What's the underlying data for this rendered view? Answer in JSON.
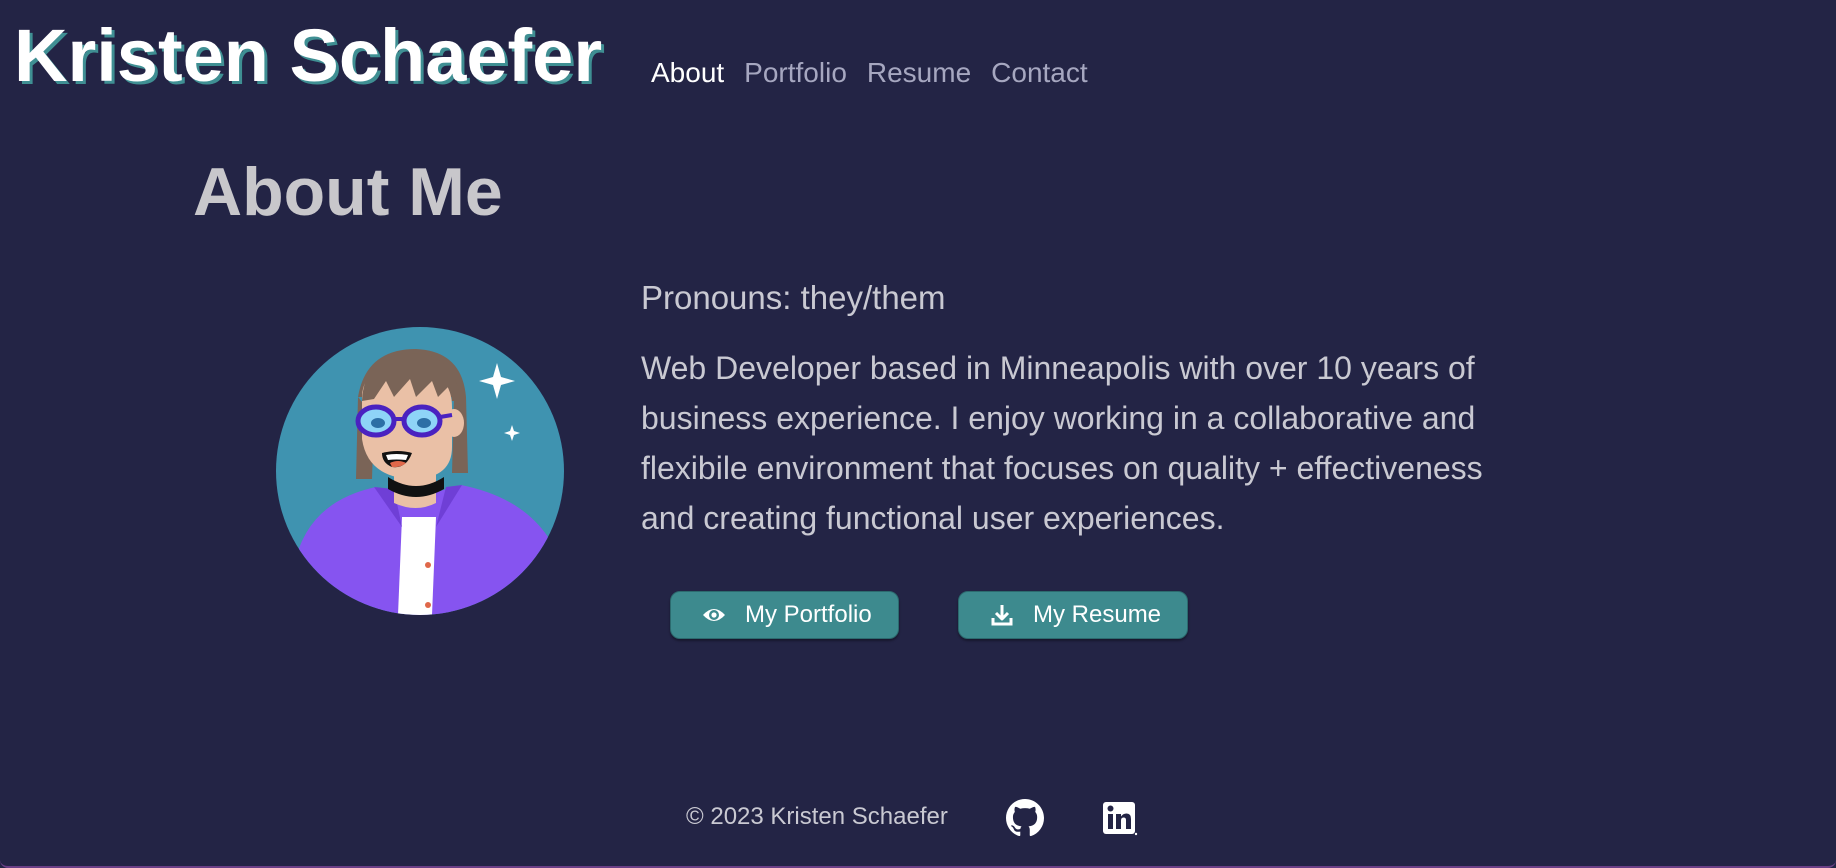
{
  "header": {
    "site_title": "Kristen Schaefer",
    "nav": [
      {
        "label": "About",
        "active": true
      },
      {
        "label": "Portfolio",
        "active": false
      },
      {
        "label": "Resume",
        "active": false
      },
      {
        "label": "Contact",
        "active": false
      }
    ]
  },
  "main": {
    "heading": "About Me",
    "pronouns": "Pronouns: they/them",
    "bio": "Web Developer based in Minneapolis with over 10 years of business experience. I enjoy working in a collaborative and flexibile environment that focuses on quality + effectiveness and creating functional user experiences.",
    "avatar_icon": "person-illustration",
    "buttons": {
      "portfolio": {
        "label": "My Portfolio",
        "icon": "eye-icon"
      },
      "resume": {
        "label": "My Resume",
        "icon": "download-icon"
      }
    }
  },
  "footer": {
    "copyright": "© 2023 Kristen Schaefer",
    "social": [
      {
        "name": "github",
        "icon": "github-icon"
      },
      {
        "name": "linkedin",
        "icon": "linkedin-icon"
      }
    ]
  },
  "colors": {
    "background": "#232445",
    "accent": "#3d8a8e",
    "text": "#c9c9d2",
    "nav_inactive": "#a6a7c0",
    "title_shadow": "#3f8f93"
  }
}
